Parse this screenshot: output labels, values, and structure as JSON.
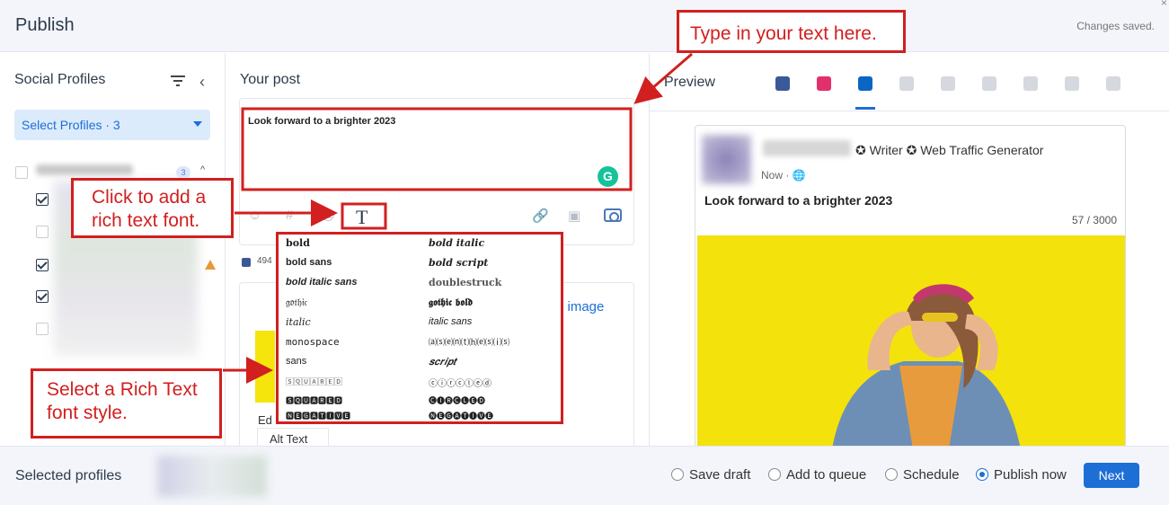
{
  "header": {
    "title": "Publish",
    "status": "Changes saved.",
    "close_glyph": "×"
  },
  "profiles": {
    "title": "Social Profiles",
    "select_label": "Select Profiles · 3",
    "group_count": "3",
    "group_caret": "^"
  },
  "post": {
    "title": "Your post",
    "text": "Look forward to a brighter 2023",
    "grammarly_glyph": "G",
    "rich_text_icon": "T",
    "toolbar_glyphs": {
      "emoji": "☺",
      "hashtag": "#",
      "mention": "@",
      "link": "🔗",
      "media": "▣"
    },
    "fb_count": "494",
    "add_image": "d image",
    "edit_label": "Ed",
    "alt_text": "Alt Text"
  },
  "font_styles": [
    {
      "label": "bold"
    },
    {
      "label": "bold italic"
    },
    {
      "label": "bold sans"
    },
    {
      "label": "𝒃𝒐𝒍𝒅 𝒔𝒄𝒓𝒊𝒑𝒕"
    },
    {
      "label": "bold italic sans"
    },
    {
      "label": "doublestruck"
    },
    {
      "label": "𝔤𝔬𝔱𝔥𝔦𝔠"
    },
    {
      "label": "𝖌𝖔𝖙𝖍𝖎𝖈 𝖇𝖔𝖑𝖉"
    },
    {
      "label": "italic"
    },
    {
      "label": "italic sans"
    },
    {
      "label": "monospace"
    },
    {
      "label": "⒜⒮⒠⒩⒯⒣⒠⒮⒤⒮"
    },
    {
      "label": "sans"
    },
    {
      "label": "𝒔𝒄𝒓𝒊𝒑𝒕"
    },
    {
      "label": "🅂🅀🅄🄰🅁🄴🄳"
    },
    {
      "label": "ⓒⓘⓡⓒⓛⓔⓓ"
    },
    {
      "label": "🆂🆀🆄🅰🆁🅴🅳"
    },
    {
      "label": "🅒🅘🅡🅒🅛🅔🅓"
    },
    {
      "label": "🅽🅴🅶🅰🆃🅸🆅🅴"
    },
    {
      "label": "🅝🅔🅖🅐🅣🅘🅥🅔"
    }
  ],
  "preview": {
    "title": "Preview",
    "tabs": [
      {
        "name": "facebook",
        "color": "#3b5998",
        "active": false
      },
      {
        "name": "instagram",
        "color": "#e1306c",
        "active": false
      },
      {
        "name": "linkedin",
        "color": "#0a66c2",
        "active": true
      },
      {
        "name": "twitter",
        "color": "#d5d8de",
        "active": false
      },
      {
        "name": "youtube",
        "color": "#d5d8de",
        "active": false
      },
      {
        "name": "google",
        "color": "#d5d8de",
        "active": false
      },
      {
        "name": "reddit",
        "color": "#d5d8de",
        "active": false
      },
      {
        "name": "pinterest",
        "color": "#d5d8de",
        "active": false
      },
      {
        "name": "tiktok",
        "color": "#d5d8de",
        "active": false
      }
    ],
    "card": {
      "role": "✪ Writer ✪ Web Traffic Generator",
      "time": "Now ·",
      "text": "Look forward to a brighter 2023",
      "char_count": "57 / 3000"
    }
  },
  "footer": {
    "selected_label": "Selected profiles",
    "options": [
      {
        "label": "Save draft",
        "checked": false
      },
      {
        "label": "Add to queue",
        "checked": false
      },
      {
        "label": "Schedule",
        "checked": false
      },
      {
        "label": "Publish now",
        "checked": true
      }
    ],
    "next_label": "Next"
  },
  "annotations": {
    "type_text": "Type in your text here.",
    "rich_text_line1": "Click to add a",
    "rich_text_line2": "rich text font.",
    "select_style_line1": "Select a Rich Text",
    "select_style_line2": "font style."
  },
  "colors": {
    "accent": "#1d6fd6",
    "annotation_red": "#d21f1f",
    "grammarly": "#15c39a",
    "image_yellow": "#f4e20c"
  }
}
